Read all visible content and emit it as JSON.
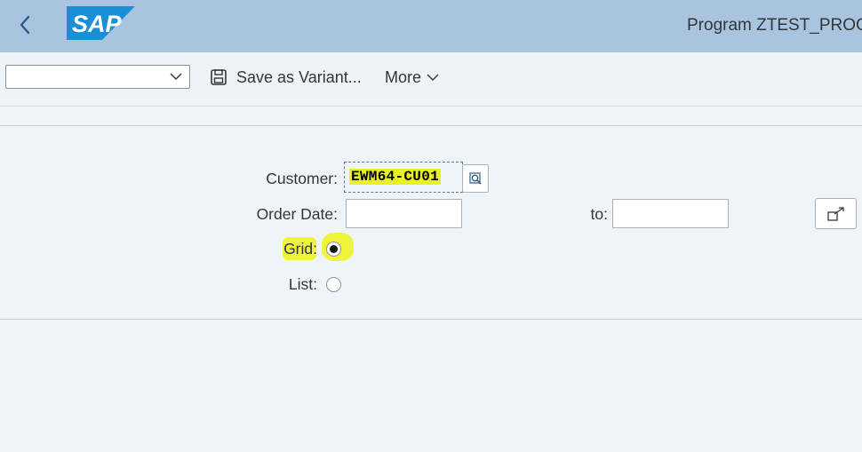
{
  "shell": {
    "logo_text": "SAP",
    "title": "Program ZTEST_PROG"
  },
  "toolbar": {
    "variant_value": "",
    "save_variant_label": "Save as Variant...",
    "more_label": "More"
  },
  "form": {
    "customer_label": "Customer:",
    "customer_value": "EWM64-CU01",
    "order_date_label": "Order Date:",
    "order_date_from": "",
    "to_label": "to:",
    "order_date_to": "",
    "grid_label": "Grid:",
    "grid_selected": true,
    "list_label": "List:",
    "list_selected": false
  },
  "colors": {
    "shell_bar": "#a8c4de",
    "page_background": "#eff4f9",
    "highlight": "#eef43a",
    "logo": "#1a8fd6"
  },
  "icons": {
    "back": "back-icon",
    "save": "save-icon",
    "more": "chevron-down-icon",
    "value_help": "value-help-icon",
    "multiple_selection": "multiple-selection-icon"
  }
}
